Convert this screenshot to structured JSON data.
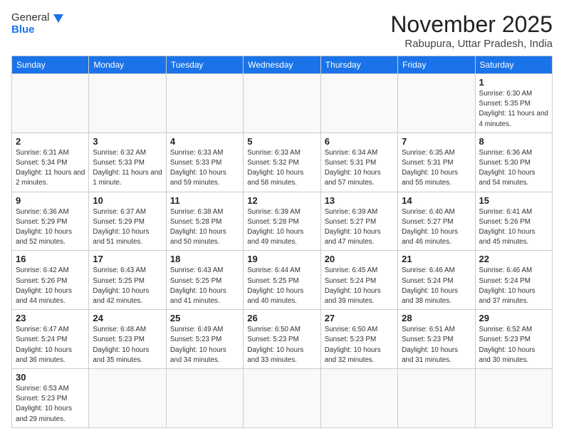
{
  "header": {
    "logo_general": "General",
    "logo_blue": "Blue",
    "month": "November 2025",
    "location": "Rabupura, Uttar Pradesh, India"
  },
  "weekdays": [
    "Sunday",
    "Monday",
    "Tuesday",
    "Wednesday",
    "Thursday",
    "Friday",
    "Saturday"
  ],
  "days": {
    "1": {
      "sunrise": "6:30 AM",
      "sunset": "5:35 PM",
      "daylight": "11 hours and 4 minutes."
    },
    "2": {
      "sunrise": "6:31 AM",
      "sunset": "5:34 PM",
      "daylight": "11 hours and 2 minutes."
    },
    "3": {
      "sunrise": "6:32 AM",
      "sunset": "5:33 PM",
      "daylight": "11 hours and 1 minute."
    },
    "4": {
      "sunrise": "6:33 AM",
      "sunset": "5:33 PM",
      "daylight": "10 hours and 59 minutes."
    },
    "5": {
      "sunrise": "6:33 AM",
      "sunset": "5:32 PM",
      "daylight": "10 hours and 58 minutes."
    },
    "6": {
      "sunrise": "6:34 AM",
      "sunset": "5:31 PM",
      "daylight": "10 hours and 57 minutes."
    },
    "7": {
      "sunrise": "6:35 AM",
      "sunset": "5:31 PM",
      "daylight": "10 hours and 55 minutes."
    },
    "8": {
      "sunrise": "6:36 AM",
      "sunset": "5:30 PM",
      "daylight": "10 hours and 54 minutes."
    },
    "9": {
      "sunrise": "6:36 AM",
      "sunset": "5:29 PM",
      "daylight": "10 hours and 52 minutes."
    },
    "10": {
      "sunrise": "6:37 AM",
      "sunset": "5:29 PM",
      "daylight": "10 hours and 51 minutes."
    },
    "11": {
      "sunrise": "6:38 AM",
      "sunset": "5:28 PM",
      "daylight": "10 hours and 50 minutes."
    },
    "12": {
      "sunrise": "6:39 AM",
      "sunset": "5:28 PM",
      "daylight": "10 hours and 49 minutes."
    },
    "13": {
      "sunrise": "6:39 AM",
      "sunset": "5:27 PM",
      "daylight": "10 hours and 47 minutes."
    },
    "14": {
      "sunrise": "6:40 AM",
      "sunset": "5:27 PM",
      "daylight": "10 hours and 46 minutes."
    },
    "15": {
      "sunrise": "6:41 AM",
      "sunset": "5:26 PM",
      "daylight": "10 hours and 45 minutes."
    },
    "16": {
      "sunrise": "6:42 AM",
      "sunset": "5:26 PM",
      "daylight": "10 hours and 44 minutes."
    },
    "17": {
      "sunrise": "6:43 AM",
      "sunset": "5:25 PM",
      "daylight": "10 hours and 42 minutes."
    },
    "18": {
      "sunrise": "6:43 AM",
      "sunset": "5:25 PM",
      "daylight": "10 hours and 41 minutes."
    },
    "19": {
      "sunrise": "6:44 AM",
      "sunset": "5:25 PM",
      "daylight": "10 hours and 40 minutes."
    },
    "20": {
      "sunrise": "6:45 AM",
      "sunset": "5:24 PM",
      "daylight": "10 hours and 39 minutes."
    },
    "21": {
      "sunrise": "6:46 AM",
      "sunset": "5:24 PM",
      "daylight": "10 hours and 38 minutes."
    },
    "22": {
      "sunrise": "6:46 AM",
      "sunset": "5:24 PM",
      "daylight": "10 hours and 37 minutes."
    },
    "23": {
      "sunrise": "6:47 AM",
      "sunset": "5:24 PM",
      "daylight": "10 hours and 36 minutes."
    },
    "24": {
      "sunrise": "6:48 AM",
      "sunset": "5:23 PM",
      "daylight": "10 hours and 35 minutes."
    },
    "25": {
      "sunrise": "6:49 AM",
      "sunset": "5:23 PM",
      "daylight": "10 hours and 34 minutes."
    },
    "26": {
      "sunrise": "6:50 AM",
      "sunset": "5:23 PM",
      "daylight": "10 hours and 33 minutes."
    },
    "27": {
      "sunrise": "6:50 AM",
      "sunset": "5:23 PM",
      "daylight": "10 hours and 32 minutes."
    },
    "28": {
      "sunrise": "6:51 AM",
      "sunset": "5:23 PM",
      "daylight": "10 hours and 31 minutes."
    },
    "29": {
      "sunrise": "6:52 AM",
      "sunset": "5:23 PM",
      "daylight": "10 hours and 30 minutes."
    },
    "30": {
      "sunrise": "6:53 AM",
      "sunset": "5:23 PM",
      "daylight": "10 hours and 29 minutes."
    }
  },
  "labels": {
    "sunrise": "Sunrise:",
    "sunset": "Sunset:",
    "daylight": "Daylight:"
  }
}
